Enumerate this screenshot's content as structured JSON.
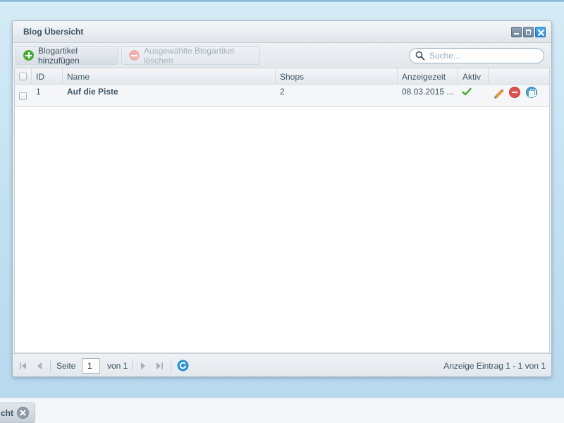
{
  "window": {
    "title": "Blog Übersicht",
    "controls": [
      "minimize-icon",
      "maximize-icon",
      "close-icon"
    ]
  },
  "toolbar": {
    "add_label": "Blogartikel hinzufügen",
    "delete_label": "Ausgewählte Blogartikel löschen",
    "delete_disabled": true,
    "search_placeholder": "Suche...",
    "search_value": ""
  },
  "grid": {
    "columns": [
      "ID",
      "Name",
      "Shops",
      "Anzeigezeit",
      "Aktiv"
    ],
    "rows": [
      {
        "id": "1",
        "name": "Auf die Piste",
        "shops": "2",
        "anzeigezeit": "08.03.2015 ...",
        "aktiv": true,
        "actions": [
          "edit-icon",
          "delete-icon",
          "duplicate-icon"
        ]
      }
    ]
  },
  "paging": {
    "page_label": "Seite",
    "page_value": "1",
    "of_label": "von 1",
    "summary": "Anzeige Eintrag 1 - 1 von 1"
  },
  "taskbar": {
    "button_label": "cht"
  },
  "colors": {
    "accent_blue": "#1d86d6",
    "add_green": "#4caa38",
    "delete_red": "#e25050",
    "active_check": "#4caa38"
  }
}
